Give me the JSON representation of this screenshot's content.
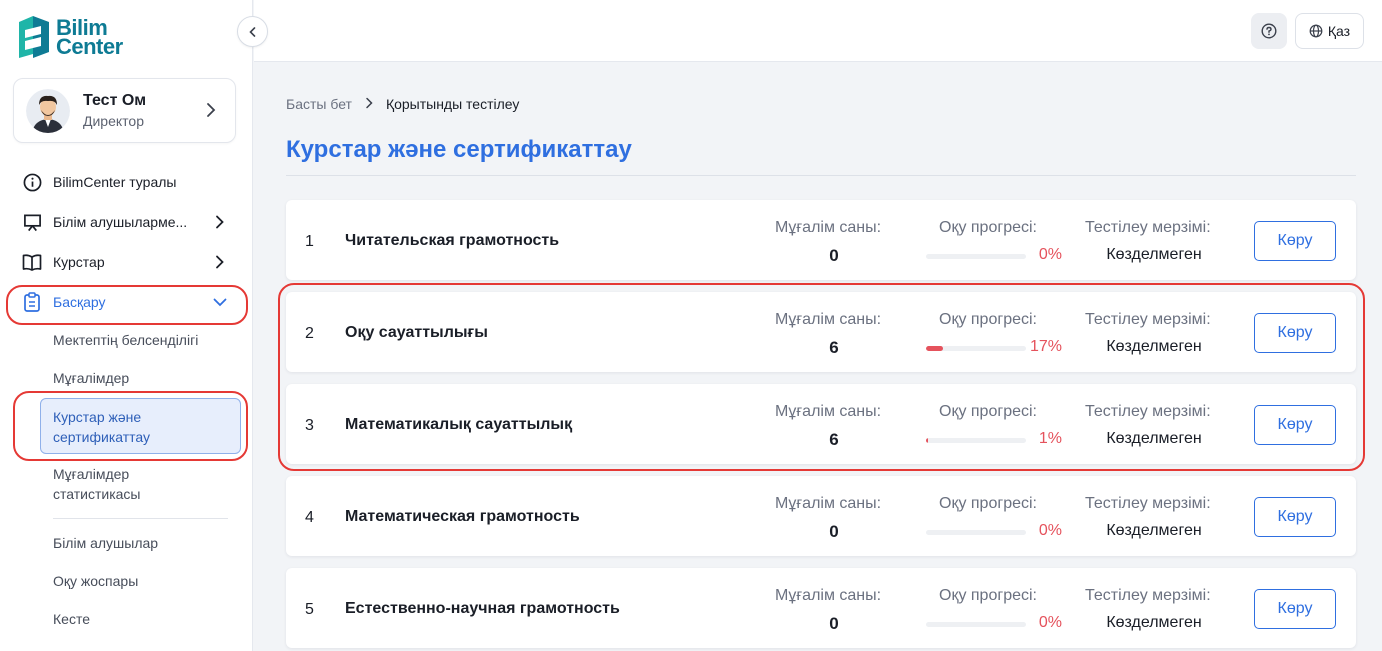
{
  "logo": {
    "line1": "Bilim",
    "line2": "Center"
  },
  "user": {
    "name": "Тест Ом",
    "role": "Директор"
  },
  "sidebar": {
    "nav": [
      {
        "label": "BilimCenter туралы",
        "icon": "info-icon"
      },
      {
        "label": "Білім алушыларме...",
        "icon": "presentation-icon"
      },
      {
        "label": "Курстар",
        "icon": "book-icon"
      },
      {
        "label": "Басқару",
        "icon": "clipboard-icon"
      }
    ],
    "sub": {
      "activity": "Мектептің белсенділігі",
      "teachers": "Мұғалімдер",
      "courses_line1": "Курстар және",
      "courses_line2": "сертификаттау",
      "stats_line1": "Мұғалімдер",
      "stats_line2": "статистикасы",
      "students": "Білім алушылар",
      "plan": "Оқу жоспары",
      "schedule": "Кесте"
    }
  },
  "header": {
    "lang": "Қаз"
  },
  "breadcrumb": {
    "home": "Басты бет",
    "current": "Қорытынды тестілеу"
  },
  "page_title": "Курстар және сертификаттау",
  "labels": {
    "teachers": "Мұғалім саны:",
    "progress": "Оқу прогресі:",
    "deadline": "Тестілеу мерзімі:",
    "view": "Көру"
  },
  "courses": [
    {
      "num": "1",
      "name": "Читательская грамотность",
      "teachers": "0",
      "progress": 0,
      "progress_text": "0%",
      "deadline": "Көзделмеген"
    },
    {
      "num": "2",
      "name": "Оқу сауаттылығы",
      "teachers": "6",
      "progress": 17,
      "progress_text": "17%",
      "deadline": "Көзделмеген"
    },
    {
      "num": "3",
      "name": "Математикалық сауаттылық",
      "teachers": "6",
      "progress": 1,
      "progress_text": "1%",
      "deadline": "Көзделмеген"
    },
    {
      "num": "4",
      "name": "Математическая грамотность",
      "teachers": "0",
      "progress": 0,
      "progress_text": "0%",
      "deadline": "Көзделмеген"
    },
    {
      "num": "5",
      "name": "Естественно-научная грамотность",
      "teachers": "0",
      "progress": 0,
      "progress_text": "0%",
      "deadline": "Көзделмеген"
    }
  ],
  "colors": {
    "accent": "#2f6fe0",
    "progress": "#e5525c",
    "highlight": "#e53935",
    "logo": "#0e7b94"
  }
}
